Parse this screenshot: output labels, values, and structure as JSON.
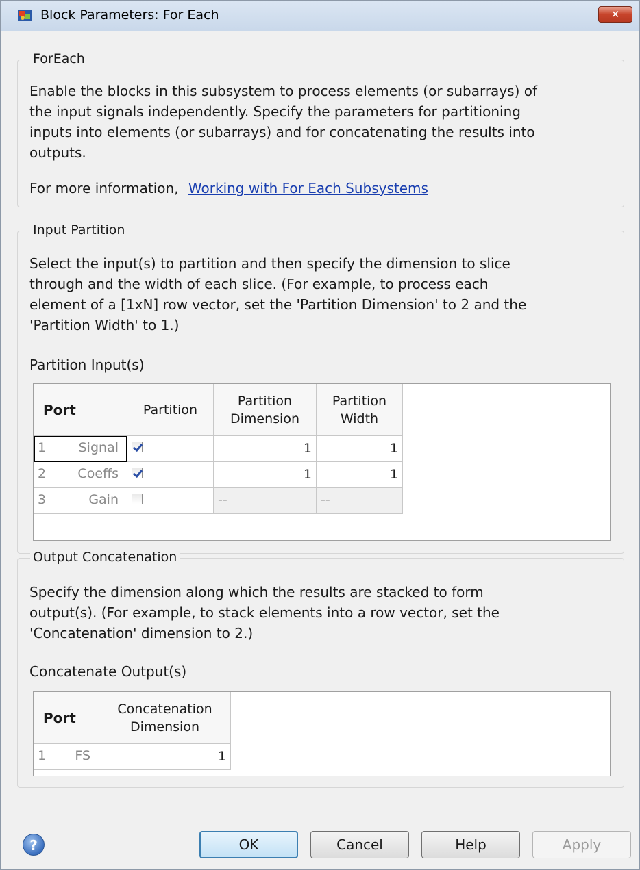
{
  "window": {
    "title": "Block Parameters: For Each",
    "close_label": "✕"
  },
  "foreach_group": {
    "title": "ForEach",
    "description_lines": [
      "Enable the blocks in this subsystem to process elements (or subarrays) of",
      "the input signals independently. Specify the parameters for partitioning",
      "inputs into elements (or subarrays) and for concatenating the results into",
      "outputs."
    ],
    "more_info_prefix": "For more information,",
    "more_info_link": "Working with For Each Subsystems"
  },
  "input_partition": {
    "title": "Input Partition",
    "description_lines": [
      "Select the input(s) to partition and then specify the dimension to slice",
      "through and the width of each slice. (For example, to process each",
      "element of a [1xN] row vector, set the 'Partition Dimension' to 2 and the",
      "'Partition Width' to 1.)"
    ],
    "table_label": "Partition Input(s)",
    "headers": {
      "port": "Port",
      "partition": "Partition",
      "dimension_1": "Partition",
      "dimension_2": "Dimension",
      "width_1": "Partition",
      "width_2": "Width"
    },
    "rows": [
      {
        "index": "1",
        "name": "Signal",
        "partition": true,
        "dimension": "1",
        "width": "1"
      },
      {
        "index": "2",
        "name": "Coeffs",
        "partition": true,
        "dimension": "1",
        "width": "1"
      },
      {
        "index": "3",
        "name": "Gain",
        "partition": false,
        "dimension": "--",
        "width": "--"
      }
    ]
  },
  "output_concatenation": {
    "title": "Output Concatenation",
    "description_lines": [
      "Specify the dimension along which the results are stacked to form",
      "output(s). (For example, to stack elements into a row vector, set the",
      "'Concatenation' dimension to 2.)"
    ],
    "table_label": "Concatenate Output(s)",
    "headers": {
      "port": "Port",
      "dimension_1": "Concatenation",
      "dimension_2": "Dimension"
    },
    "rows": [
      {
        "index": "1",
        "name": "FS",
        "dimension": "1"
      }
    ]
  },
  "buttons": {
    "help_icon": "?",
    "ok": "OK",
    "cancel": "Cancel",
    "help": "Help",
    "apply": "Apply"
  }
}
